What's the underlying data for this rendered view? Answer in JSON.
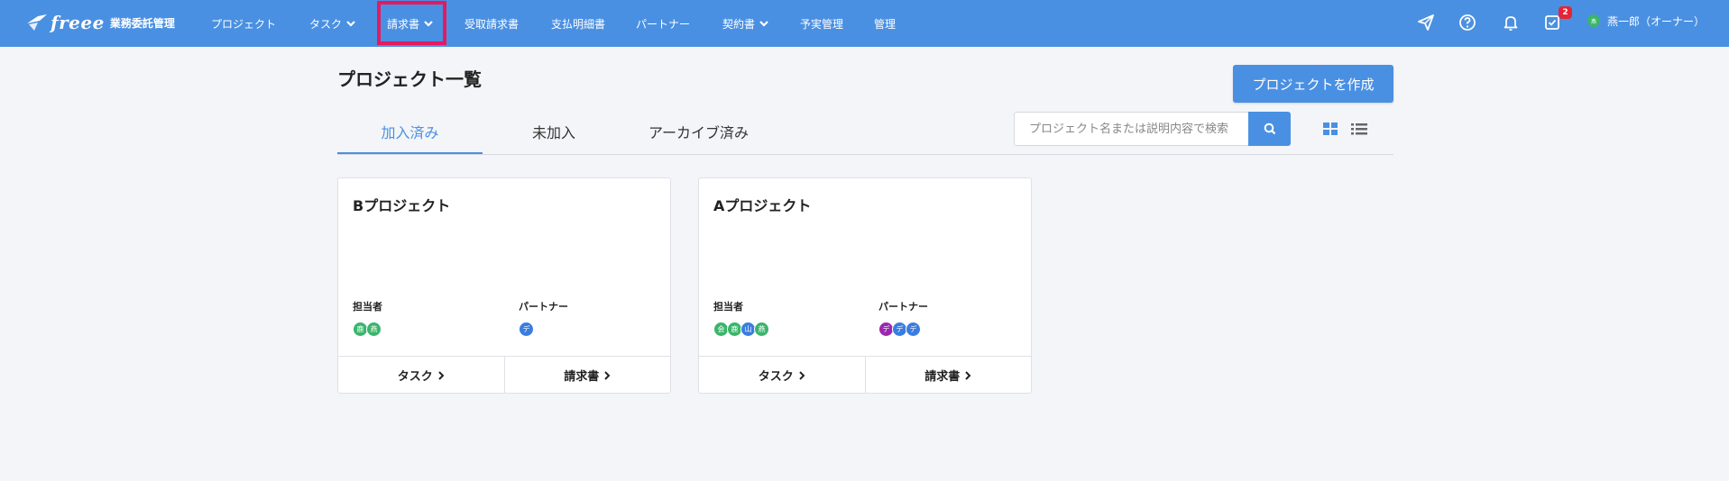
{
  "header": {
    "logo_text": "freee",
    "logo_subtitle": "業務委託管理",
    "nav": [
      {
        "label": "プロジェクト"
      },
      {
        "label": "タスク"
      },
      {
        "label": "請求書"
      },
      {
        "label": "受取請求書"
      },
      {
        "label": "支払明細書"
      },
      {
        "label": "パートナー"
      },
      {
        "label": "契約書"
      },
      {
        "label": "予実管理"
      },
      {
        "label": "管理"
      }
    ],
    "icons": [
      "send-icon",
      "help-icon",
      "bell-icon",
      "checkbox-icon"
    ],
    "notification_badge": "2",
    "user": {
      "avatar": "燕",
      "name": "燕一郎（オーナー）"
    },
    "accent_color": "#4a90e2",
    "highlight_color": "#e5195f"
  },
  "page": {
    "title": "プロジェクト一覧",
    "create_button": "プロジェクトを作成",
    "tabs": [
      {
        "label": "加入済み",
        "active": true
      },
      {
        "label": "未加入",
        "active": false
      },
      {
        "label": "アーカイブ済み",
        "active": false
      }
    ],
    "search": {
      "placeholder": "プロジェクト名または説明内容で検索"
    }
  },
  "projects": [
    {
      "name": "Bプロジェクト",
      "assignee_label": "担当者",
      "partner_label": "パートナー",
      "assignees": [
        {
          "initial": "鹿",
          "color": "#3ab56b"
        },
        {
          "initial": "燕",
          "color": "#3ab56b"
        }
      ],
      "partners": [
        {
          "initial": "デ",
          "color": "#3a7de0"
        }
      ],
      "task_link": "タスク",
      "invoice_link": "請求書"
    },
    {
      "name": "Aプロジェクト",
      "assignee_label": "担当者",
      "partner_label": "パートナー",
      "assignees": [
        {
          "initial": "会",
          "color": "#3ab56b"
        },
        {
          "initial": "鹿",
          "color": "#3ab56b"
        },
        {
          "initial": "山",
          "color": "#3a7de0"
        },
        {
          "initial": "燕",
          "color": "#3ab56b"
        }
      ],
      "partners": [
        {
          "initial": "デ",
          "color": "#9b27b0"
        },
        {
          "initial": "デ",
          "color": "#3a7de0"
        },
        {
          "initial": "デ",
          "color": "#3a7de0"
        }
      ],
      "task_link": "タスク",
      "invoice_link": "請求書"
    }
  ]
}
